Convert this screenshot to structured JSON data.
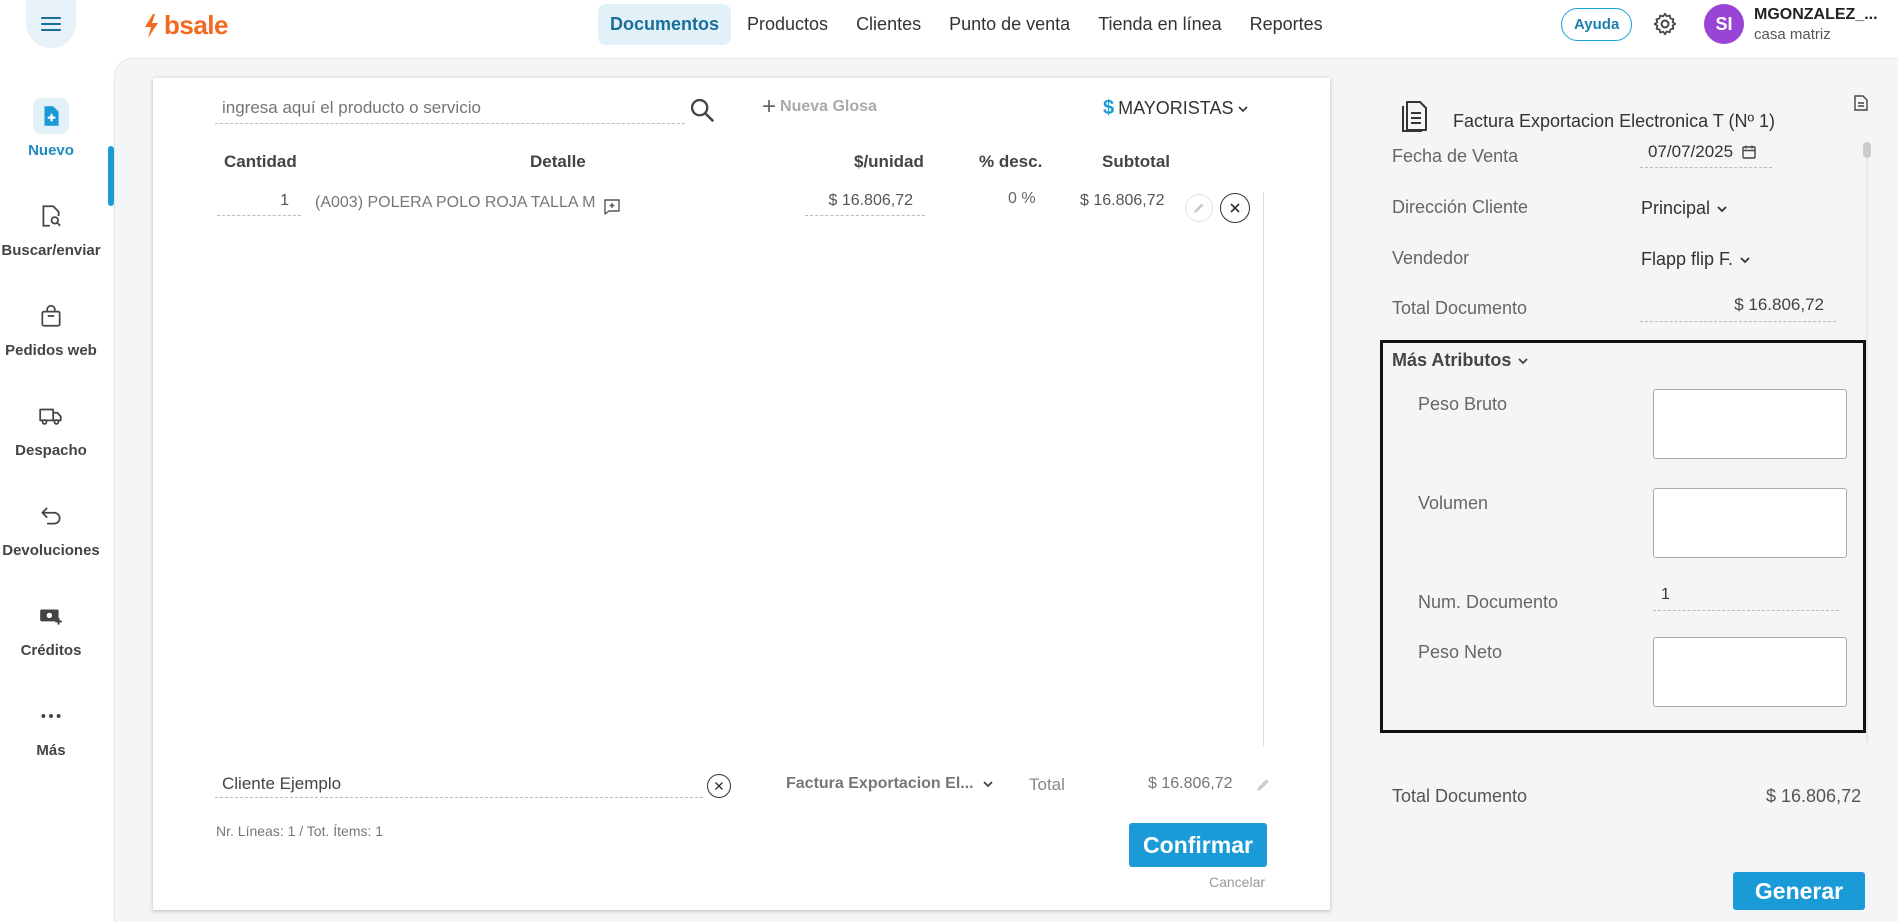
{
  "topbar": {
    "logo_text": "bsale",
    "nav": [
      {
        "label": "Documentos",
        "active": true
      },
      {
        "label": "Productos"
      },
      {
        "label": "Clientes"
      },
      {
        "label": "Punto de venta"
      },
      {
        "label": "Tienda en línea"
      },
      {
        "label": "Reportes"
      }
    ],
    "help_label": "Ayuda",
    "avatar_initials": "SI",
    "user_name": "MGONZALEZ_...",
    "user_branch": "casa matriz"
  },
  "sidebar": {
    "items": [
      {
        "label": "Nuevo",
        "icon": "new-document-icon",
        "active": true
      },
      {
        "label": "Buscar/enviar",
        "icon": "search-document-icon"
      },
      {
        "label": "Pedidos web",
        "icon": "shopping-bag-icon"
      },
      {
        "label": "Despacho",
        "icon": "truck-icon"
      },
      {
        "label": "Devoluciones",
        "icon": "return-arrow-icon"
      },
      {
        "label": "Créditos",
        "icon": "cash-plus-icon"
      },
      {
        "label": "Más",
        "icon": "more-dots-icon"
      }
    ]
  },
  "editor": {
    "search_placeholder": "ingresa aquí el producto o servicio",
    "nueva_glosa": "Nueva Glosa",
    "price_list": "MAYORISTAS",
    "price_list_symbol": "$",
    "columns": {
      "cantidad": "Cantidad",
      "detalle": "Detalle",
      "unidad": "$/unidad",
      "descuento": "% desc.",
      "subtotal": "Subtotal"
    },
    "rows": [
      {
        "cantidad": "1",
        "detalle": "(A003) POLERA POLO ROJA TALLA M",
        "precio": "$ 16.806,72",
        "descuento": "0 %",
        "subtotal": "$ 16.806,72"
      }
    ],
    "client_value": "Cliente Ejemplo",
    "doc_type": "Factura Exportacion El...",
    "total_label": "Total",
    "total_value": "$ 16.806,72",
    "lines_info": "Nr. Líneas: 1 / Tot. Ítems: 1",
    "confirm_label": "Confirmar",
    "cancel_label": "Cancelar"
  },
  "panel": {
    "doc_title": "Factura Exportacion Electronica T (Nº 1)",
    "fecha_label": "Fecha de Venta",
    "fecha_value": "07/07/2025",
    "direccion_label": "Dirección Cliente",
    "direccion_value": "Principal",
    "vendedor_label": "Vendedor",
    "vendedor_value": "Flapp flip F.",
    "total_doc_label": "Total Documento",
    "total_doc_value": "$ 16.806,72",
    "mas_atributos": "Más Atributos",
    "peso_bruto_label": "Peso Bruto",
    "volumen_label": "Volumen",
    "num_documento_label": "Num. Documento",
    "num_documento_value": "1",
    "peso_neto_label": "Peso Neto",
    "summary_label": "Total Documento",
    "summary_value": "$ 16.806,72",
    "generar_label": "Generar"
  },
  "colors": {
    "accent": "#1a9ad6",
    "brand": "#f26a21",
    "avatar": "#9a44d6"
  }
}
